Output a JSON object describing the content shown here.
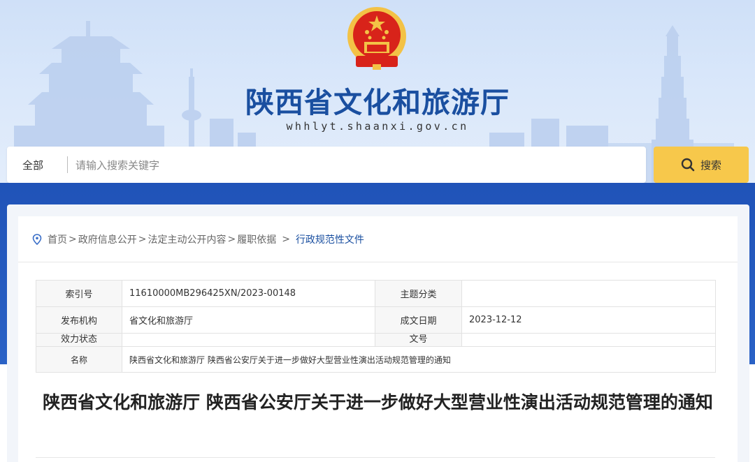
{
  "header": {
    "site_title": "陕西省文化和旅游厅",
    "site_domain": "whhlyt.shaanxi.gov.cn",
    "emblem_icon": "national-emblem-icon",
    "colors": {
      "title_blue": "#1a4fa0",
      "emblem_red": "#d8231a",
      "emblem_gold": "#f3c246"
    }
  },
  "search": {
    "scope_label": "全部",
    "placeholder": "请输入搜索关键字",
    "button_label": "搜索",
    "button_color": "#f7c84b"
  },
  "breadcrumb": {
    "icon": "location-pin-icon",
    "items": [
      "首页",
      "政府信息公开",
      "法定主动公开内容",
      "履职依据"
    ],
    "current": "行政规范性文件",
    "separator": ">"
  },
  "meta": {
    "index_label": "索引号",
    "index_value": "11610000MB296425XN/2023-00148",
    "topic_label": "主题分类",
    "topic_value": "",
    "publisher_label": "发布机构",
    "publisher_value": "省文化和旅游厅",
    "date_label": "成文日期",
    "date_value": "2023-12-12",
    "validity_label": "效力状态",
    "validity_value": "",
    "docno_label": "文号",
    "docno_value": "",
    "name_label": "名称",
    "name_value": "陕西省文化和旅游厅 陕西省公安厅关于进一步做好大型营业性演出活动规范管理的通知"
  },
  "article": {
    "title": "陕西省文化和旅游厅 陕西省公安厅关于进一步做好大型营业性演出活动规范管理的通知"
  },
  "theme": {
    "band_blue": "#2053b8"
  }
}
